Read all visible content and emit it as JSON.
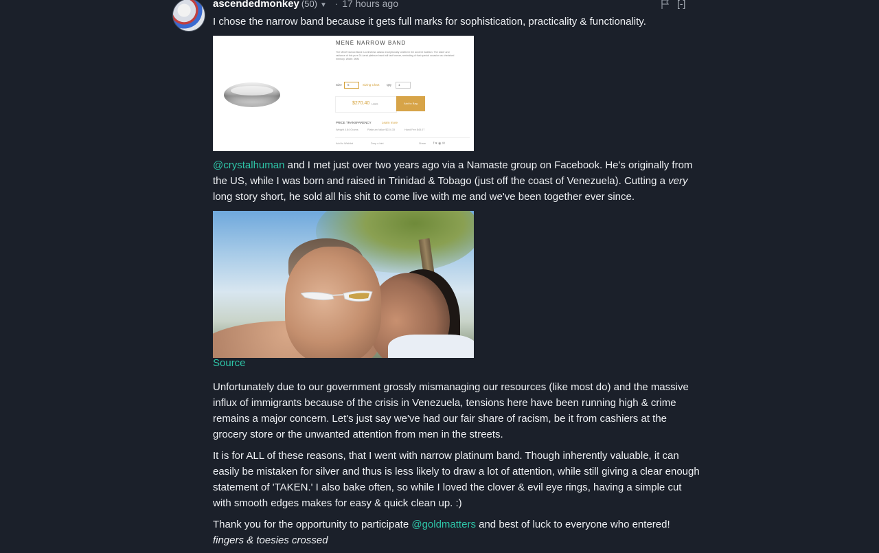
{
  "comment": {
    "author": "ascendedmonkey",
    "reputation": "(50)",
    "separator": "·",
    "time": "17 hours ago",
    "collapse_label": "[-]",
    "intro": "I chose the narrow band because it gets full marks for sophistication, practicality & functionality.",
    "product_image": {
      "title": "MENĒ NARROW BAND",
      "description": "The Menē Narrow Band is a timeless classic exceptionally crafted in the ancient tradition. The luster and radiance of this pure 24-karat platinum band will last forever, reminding of that special occasion as cherished memory. Width: 3MM",
      "size_label": "Size",
      "size_value": "6",
      "sizing_chart": "Sizing Chart",
      "qty_label": "Qty",
      "qty_value": "1",
      "price": "$270.40",
      "price_currency": "USD",
      "add_button": "Add to Bag",
      "transparency": "PRICE TRANSPARENCY",
      "learn_more": "Learn more",
      "weight": "Weight 4.84 Grams",
      "platinum_value": "Platinum Value $224.33",
      "hand_fee": "Hand Fee $45.07",
      "wishlist": "Add to Wishlist",
      "drop_hint": "Drop a hint",
      "share": "Share"
    },
    "p2_mention": "@crystalhuman",
    "p2_a": " and I met just over two years ago via a Namaste group on Facebook. He's originally from the US, while I was born and raised in Trinidad & Tobago (just off the coast of Venezuela). Cutting a ",
    "p2_em": "very",
    "p2_b": " long story short, he sold all his shit to come live with me and we've been together ever since.",
    "source_label": "Source",
    "p3": "Unfortunately due to our government grossly mismanaging our resources (like most do) and the massive influx of immigrants because of the crisis in Venezuela, tensions here have been running high & crime remains a major concern. Let's just say we've had our fair share of racism, be it from cashiers at the grocery store or the unwanted attention from men in the streets.",
    "p4": "It is for ALL of these reasons, that I went with narrow platinum band. Though inherently valuable, it can easily be mistaken for silver and thus is less likely to draw a lot of attention, while still giving a clear enough statement of 'TAKEN.' I also bake often, so while I loved the clover & evil eye rings, having a simple cut with smooth edges makes for easy & quick clean up. :)",
    "p5_a": "Thank you for the opportunity to participate ",
    "p5_mention": "@goldmatters",
    "p5_b": " and best of luck to everyone who entered!",
    "p5_em": "fingers & toesies crossed"
  },
  "icons": {
    "caret": "chevron-down-icon",
    "flag": "flag-icon"
  },
  "colors": {
    "background": "#1b202a",
    "text": "#eef0f3",
    "mention": "#2ec5a8",
    "accent_gold": "#d7a448"
  }
}
